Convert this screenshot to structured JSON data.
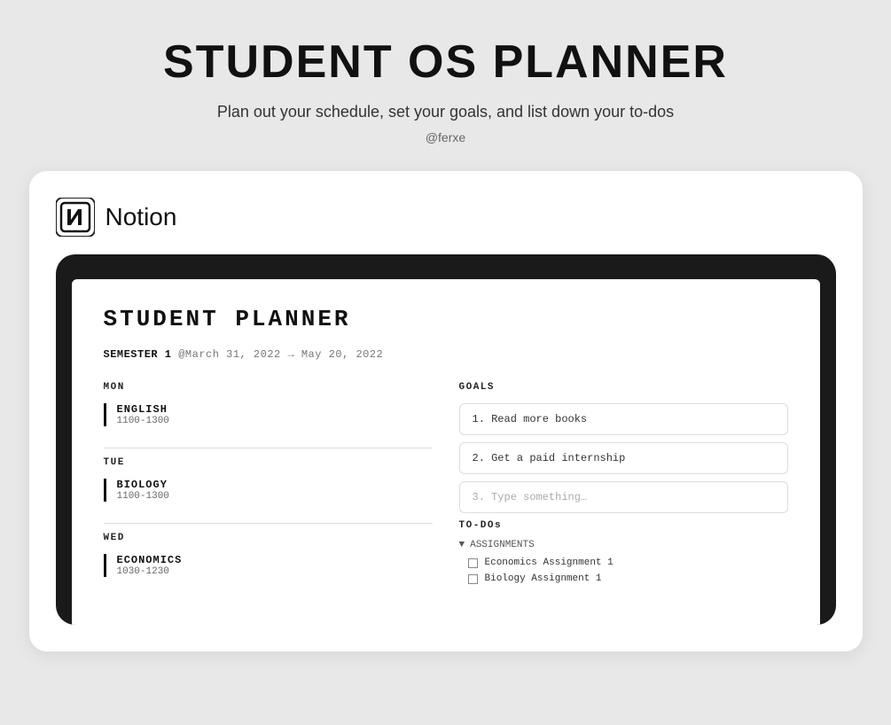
{
  "header": {
    "title": "STUDENT OS PLANNER",
    "subtitle": "Plan out your schedule, set your goals, and list down your to-dos",
    "handle": "@ferxe"
  },
  "brand": {
    "name": "Notion"
  },
  "planner": {
    "title": "STUDENT  PLANNER",
    "semester_label": "SEMESTER 1",
    "semester_date": "@March 31, 2022 → May 20, 2022",
    "schedule": [
      {
        "day": "MON",
        "subject": "ENGLISH",
        "time": "1100-1300"
      },
      {
        "day": "TUE",
        "subject": "BIOLOGY",
        "time": "1100-1300"
      },
      {
        "day": "WED",
        "subject": "ECONOMICS",
        "time": "1030-1230"
      }
    ],
    "goals": {
      "label": "GOALS",
      "items": [
        {
          "num": "1.",
          "text": "Read more books"
        },
        {
          "num": "2.",
          "text": "Get a paid internship"
        },
        {
          "num": "3.",
          "text": "Type something…",
          "placeholder": true
        }
      ]
    },
    "todos": {
      "label": "TO-DOs",
      "group": "▼  ASSIGNMENTS",
      "items": [
        "Economics Assignment 1",
        "Biology Assignment 1"
      ]
    }
  }
}
